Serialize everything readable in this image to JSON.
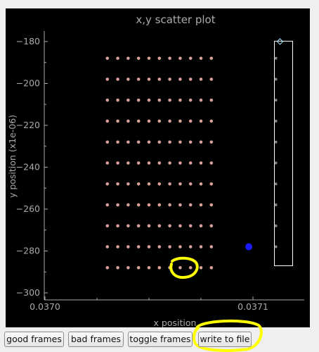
{
  "buttons": {
    "good_frames": "good frames",
    "bad_frames": "bad frames",
    "toggle_frames": "toggle frames",
    "write_to_file": "write to file"
  },
  "colors": {
    "background": "#000000",
    "axis_text": "#aaaaaa",
    "good_point": "#d9a09a",
    "masked_point": "#8a8a8a",
    "selected_point": "#1a1aff",
    "annotation": "#ffff00"
  },
  "chart_data": {
    "type": "scatter",
    "title": "x,y scatter plot",
    "xlabel": "x position",
    "ylabel": "y position (x1e-06)",
    "xticks": [
      "0.0370",
      "0.0371"
    ],
    "yticks": [
      -180,
      -200,
      -220,
      -240,
      -260,
      -280,
      -300
    ],
    "ylim": [
      -302,
      -176
    ],
    "grid": false,
    "series": [
      {
        "points_color": "#d9a09a",
        "x_columns": [
          0.03703,
          0.037035,
          0.03704,
          0.037045,
          0.03705,
          0.037055,
          0.03706,
          0.037065,
          0.03707,
          0.037075,
          0.03708
        ],
        "y_rows": [
          -188,
          -198,
          -208,
          -218,
          -228,
          -238,
          -248,
          -258,
          -268,
          -278,
          -288
        ]
      },
      {
        "points_color": "#8a8a8a",
        "x": [
          0.037111,
          0.037111,
          0.037111,
          0.037111,
          0.037111,
          0.037111,
          0.037111,
          0.037111,
          0.037111,
          0.037111
        ],
        "y": [
          -188,
          -198,
          -208,
          -218,
          -228,
          -238,
          -248,
          -258,
          -268,
          -278
        ]
      },
      {
        "points_color": "#1a1aff",
        "x": [
          0.037098
        ],
        "y": [
          -278
        ]
      }
    ],
    "marker": {
      "x": 0.037113,
      "y": -180,
      "shape": "diamond"
    }
  }
}
